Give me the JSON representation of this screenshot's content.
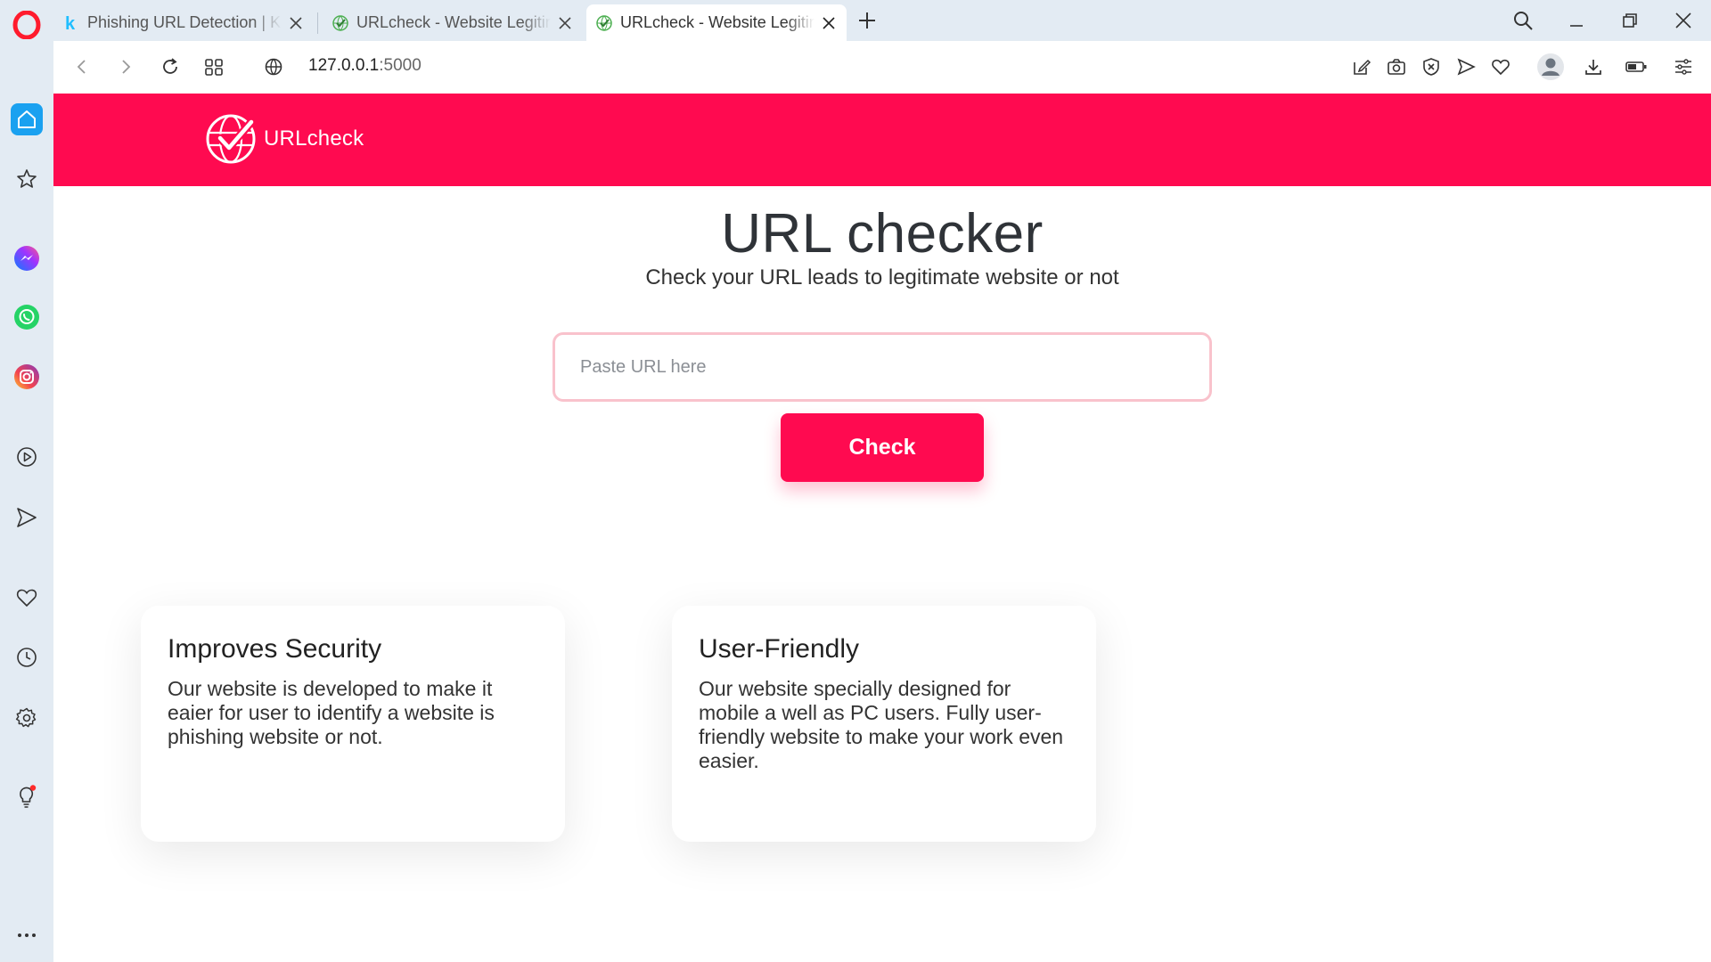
{
  "browser": {
    "tabs": [
      {
        "title": "Phishing URL Detection | Ka",
        "favicon": "kaggle-icon",
        "active": false
      },
      {
        "title": "URLcheck - Website Legitim",
        "favicon": "globe-check-icon",
        "active": false
      },
      {
        "title": "URLcheck - Website Legitim",
        "favicon": "globe-check-icon",
        "active": true
      }
    ],
    "address": {
      "host": "127.0.0.1",
      "port": ":5000"
    }
  },
  "site": {
    "brand": "URLcheck",
    "hero": {
      "title": "URL checker",
      "subtitle": "Check your URL leads to legitimate website or not"
    },
    "form": {
      "placeholder": "Paste URL here",
      "value": "",
      "submit_label": "Check"
    },
    "features": [
      {
        "title": "Improves Security",
        "text": "Our website is developed to make it eaier for user to identify a website is phishing website or not."
      },
      {
        "title": "User-Friendly",
        "text": "Our website specially designed for mobile a well as PC users. Fully user-friendly website to make your work even easier."
      }
    ]
  },
  "colors": {
    "brand": "#ff0a50",
    "input_border": "#f9c2cc",
    "browser_chrome": "#e3ebf3",
    "sidebar_home": "#1aa1f0"
  }
}
